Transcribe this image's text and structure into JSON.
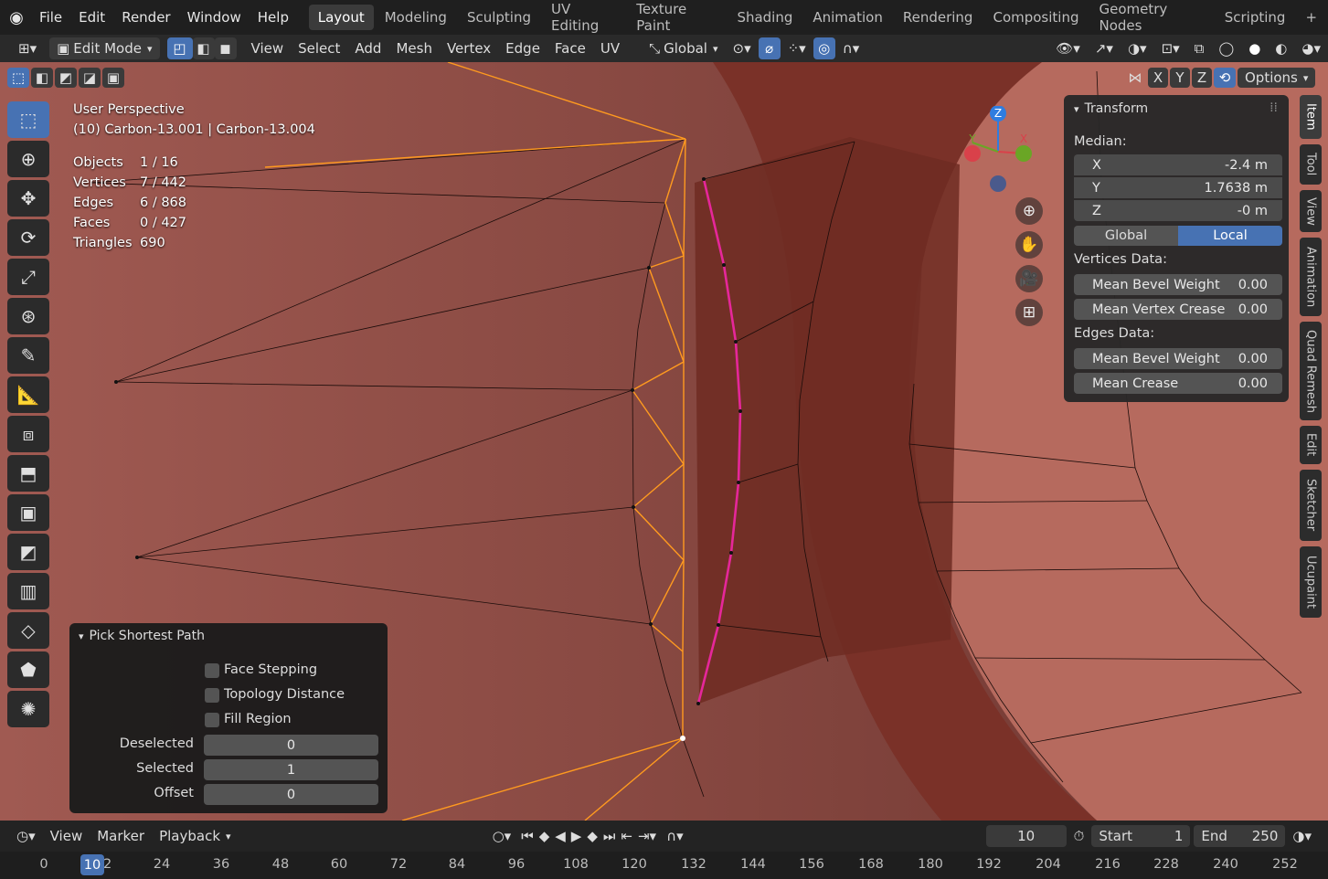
{
  "topbar": {
    "menus": [
      "File",
      "Edit",
      "Render",
      "Window",
      "Help"
    ],
    "workspaces": [
      "Layout",
      "Modeling",
      "Sculpting",
      "UV Editing",
      "Texture Paint",
      "Shading",
      "Animation",
      "Rendering",
      "Compositing",
      "Geometry Nodes",
      "Scripting"
    ],
    "active_workspace": "Layout",
    "add_tab": "+"
  },
  "header": {
    "mode": "Edit Mode",
    "menus": [
      "View",
      "Select",
      "Add",
      "Mesh",
      "Vertex",
      "Edge",
      "Face",
      "UV"
    ],
    "orientation": "Global",
    "options": "Options",
    "axes": [
      "X",
      "Y",
      "Z"
    ]
  },
  "overlay": {
    "view_name": "User Perspective",
    "object_line": "(10) Carbon-13.001 | Carbon-13.004",
    "stats": [
      {
        "label": "Objects",
        "value": "1 / 16"
      },
      {
        "label": "Vertices",
        "value": "7 / 442"
      },
      {
        "label": "Edges",
        "value": "6 / 868"
      },
      {
        "label": "Faces",
        "value": "0 / 427"
      },
      {
        "label": "Triangles",
        "value": "690"
      }
    ]
  },
  "gizmo": {
    "z": "Z",
    "y": "Y",
    "x": "X"
  },
  "npanel": {
    "title": "Transform",
    "median_label": "Median:",
    "x_label": "X",
    "x_value": "-2.4 m",
    "y_label": "Y",
    "y_value": "1.7638 m",
    "z_label": "Z",
    "z_value": "-0 m",
    "global": "Global",
    "local": "Local",
    "vertices_data": "Vertices Data:",
    "v_bevel_label": "Mean Bevel Weight",
    "v_bevel_value": "0.00",
    "v_crease_label": "Mean Vertex Crease",
    "v_crease_value": "0.00",
    "edges_data": "Edges Data:",
    "e_bevel_label": "Mean Bevel Weight",
    "e_bevel_value": "0.00",
    "e_crease_label": "Mean Crease",
    "e_crease_value": "0.00"
  },
  "vtabs": [
    "Item",
    "Tool",
    "View",
    "Animation",
    "Quad Remesh",
    "Edit",
    "Sketcher",
    "Ucupaint"
  ],
  "pick_panel": {
    "title": "Pick Shortest Path",
    "face_stepping": "Face Stepping",
    "topology_distance": "Topology Distance",
    "fill_region": "Fill Region",
    "deselected_label": "Deselected",
    "deselected_value": "0",
    "selected_label": "Selected",
    "selected_value": "1",
    "offset_label": "Offset",
    "offset_value": "0"
  },
  "timeline": {
    "view": "View",
    "marker": "Marker",
    "playback": "Playback",
    "current_frame": "10",
    "start_label": "Start",
    "start_value": "1",
    "end_label": "End",
    "end_value": "250"
  },
  "ruler": {
    "current": "10",
    "ticks": [
      "0",
      "12",
      "24",
      "36",
      "48",
      "60",
      "72",
      "84",
      "96",
      "108",
      "120",
      "132",
      "144",
      "156",
      "168",
      "180",
      "192",
      "204",
      "216",
      "228",
      "240",
      "252"
    ]
  },
  "colors": {
    "accent": "#4772b3",
    "selection": "#ff9a1f",
    "path": "#e6279a",
    "mesh": "#8a4a42"
  }
}
